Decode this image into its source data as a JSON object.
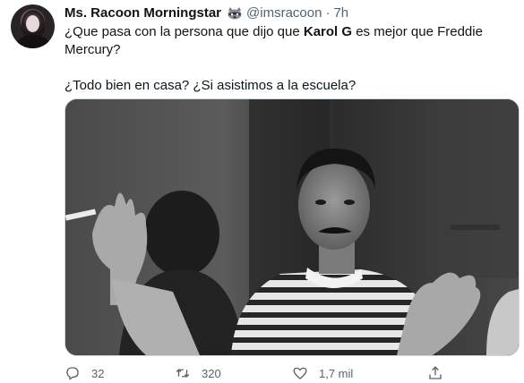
{
  "tweet": {
    "display_name": "Ms. Racoon Morningstar",
    "name_emoji_icon": "raccoon-icon",
    "handle": "@imsracoon",
    "separator": "·",
    "time": "7h",
    "text_pre": "¿Que pasa con la persona que dijo que ",
    "text_bold": "Karol G",
    "text_post": " es mejor que Freddie Mercury?",
    "text_second": "¿Todo bien en casa? ¿Si asistimos a la escuela?"
  },
  "actions": {
    "reply_icon": "reply-icon",
    "reply_count": "32",
    "retweet_icon": "retweet-icon",
    "retweet_count": "320",
    "like_icon": "heart-icon",
    "like_count": "1,7 mil",
    "share_icon": "share-icon"
  },
  "colors": {
    "text": "#0f1419",
    "secondary": "#536471",
    "border": "#cfd9de"
  }
}
